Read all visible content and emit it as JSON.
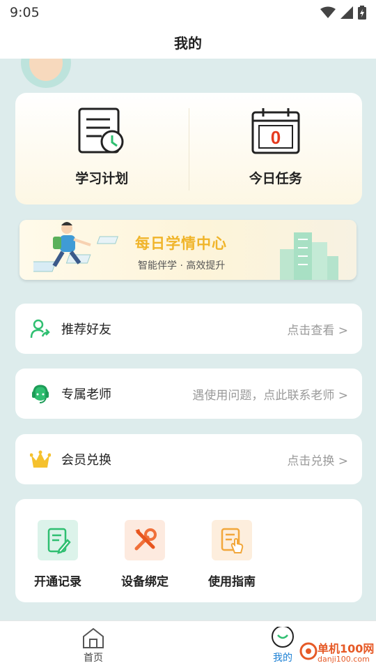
{
  "status": {
    "time": "9:05"
  },
  "header": {
    "title": "我的"
  },
  "plan": {
    "study_plan_label": "学习计划",
    "today_task_label": "今日任务",
    "today_task_count": "0"
  },
  "banner": {
    "title": "每日学情中心",
    "subtitle": "智能伴学 · 高效提升"
  },
  "rows": {
    "recommend": {
      "label": "推荐好友",
      "hint": "点击查看 >"
    },
    "teacher": {
      "label": "专属老师",
      "hint": "遇使用问题，点此联系老师 >"
    },
    "member": {
      "label": "会员兑换",
      "hint": "点击兑换 >"
    }
  },
  "tools": {
    "records": "开通记录",
    "binding": "设备绑定",
    "guide": "使用指南"
  },
  "tabbar": {
    "home": "首页",
    "mine": "我的"
  },
  "watermark": {
    "name": "单机100网",
    "url": "danji100.com"
  },
  "colors": {
    "accent_green": "#2fbf71",
    "banner_gold": "#f0b429",
    "watermark_orange": "#e65a27"
  }
}
